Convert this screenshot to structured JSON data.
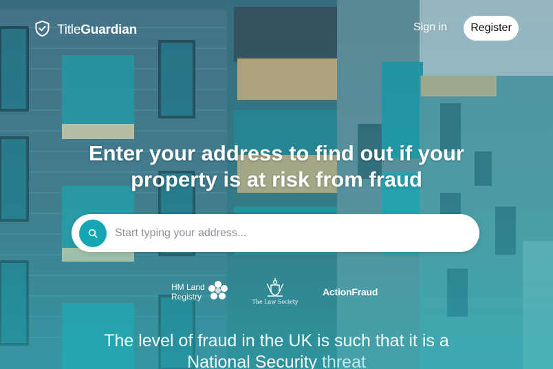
{
  "brand": {
    "name_light": "Title",
    "name_bold": "Guardian",
    "logo_icon": "shield-check-icon"
  },
  "nav": {
    "signin_label": "Sign in",
    "register_label": "Register"
  },
  "hero": {
    "headline_line1": "Enter your address to find out if your",
    "headline_line2": "property is at risk from fraud"
  },
  "search": {
    "placeholder": "Start typing your address...",
    "value": "",
    "icon": "search-icon"
  },
  "partners": {
    "hmlr_line1": "HM Land",
    "hmlr_line2": "Registry",
    "law_society": "The Law Society",
    "action_fraud": "ActionFraud"
  },
  "tagline": {
    "line1": "The level of fraud in the UK is such that it is a",
    "line2_main": "National Security",
    "line2_end": "threat"
  },
  "colors": {
    "accent": "#16a6b3",
    "register_bg": "#ffffff"
  }
}
